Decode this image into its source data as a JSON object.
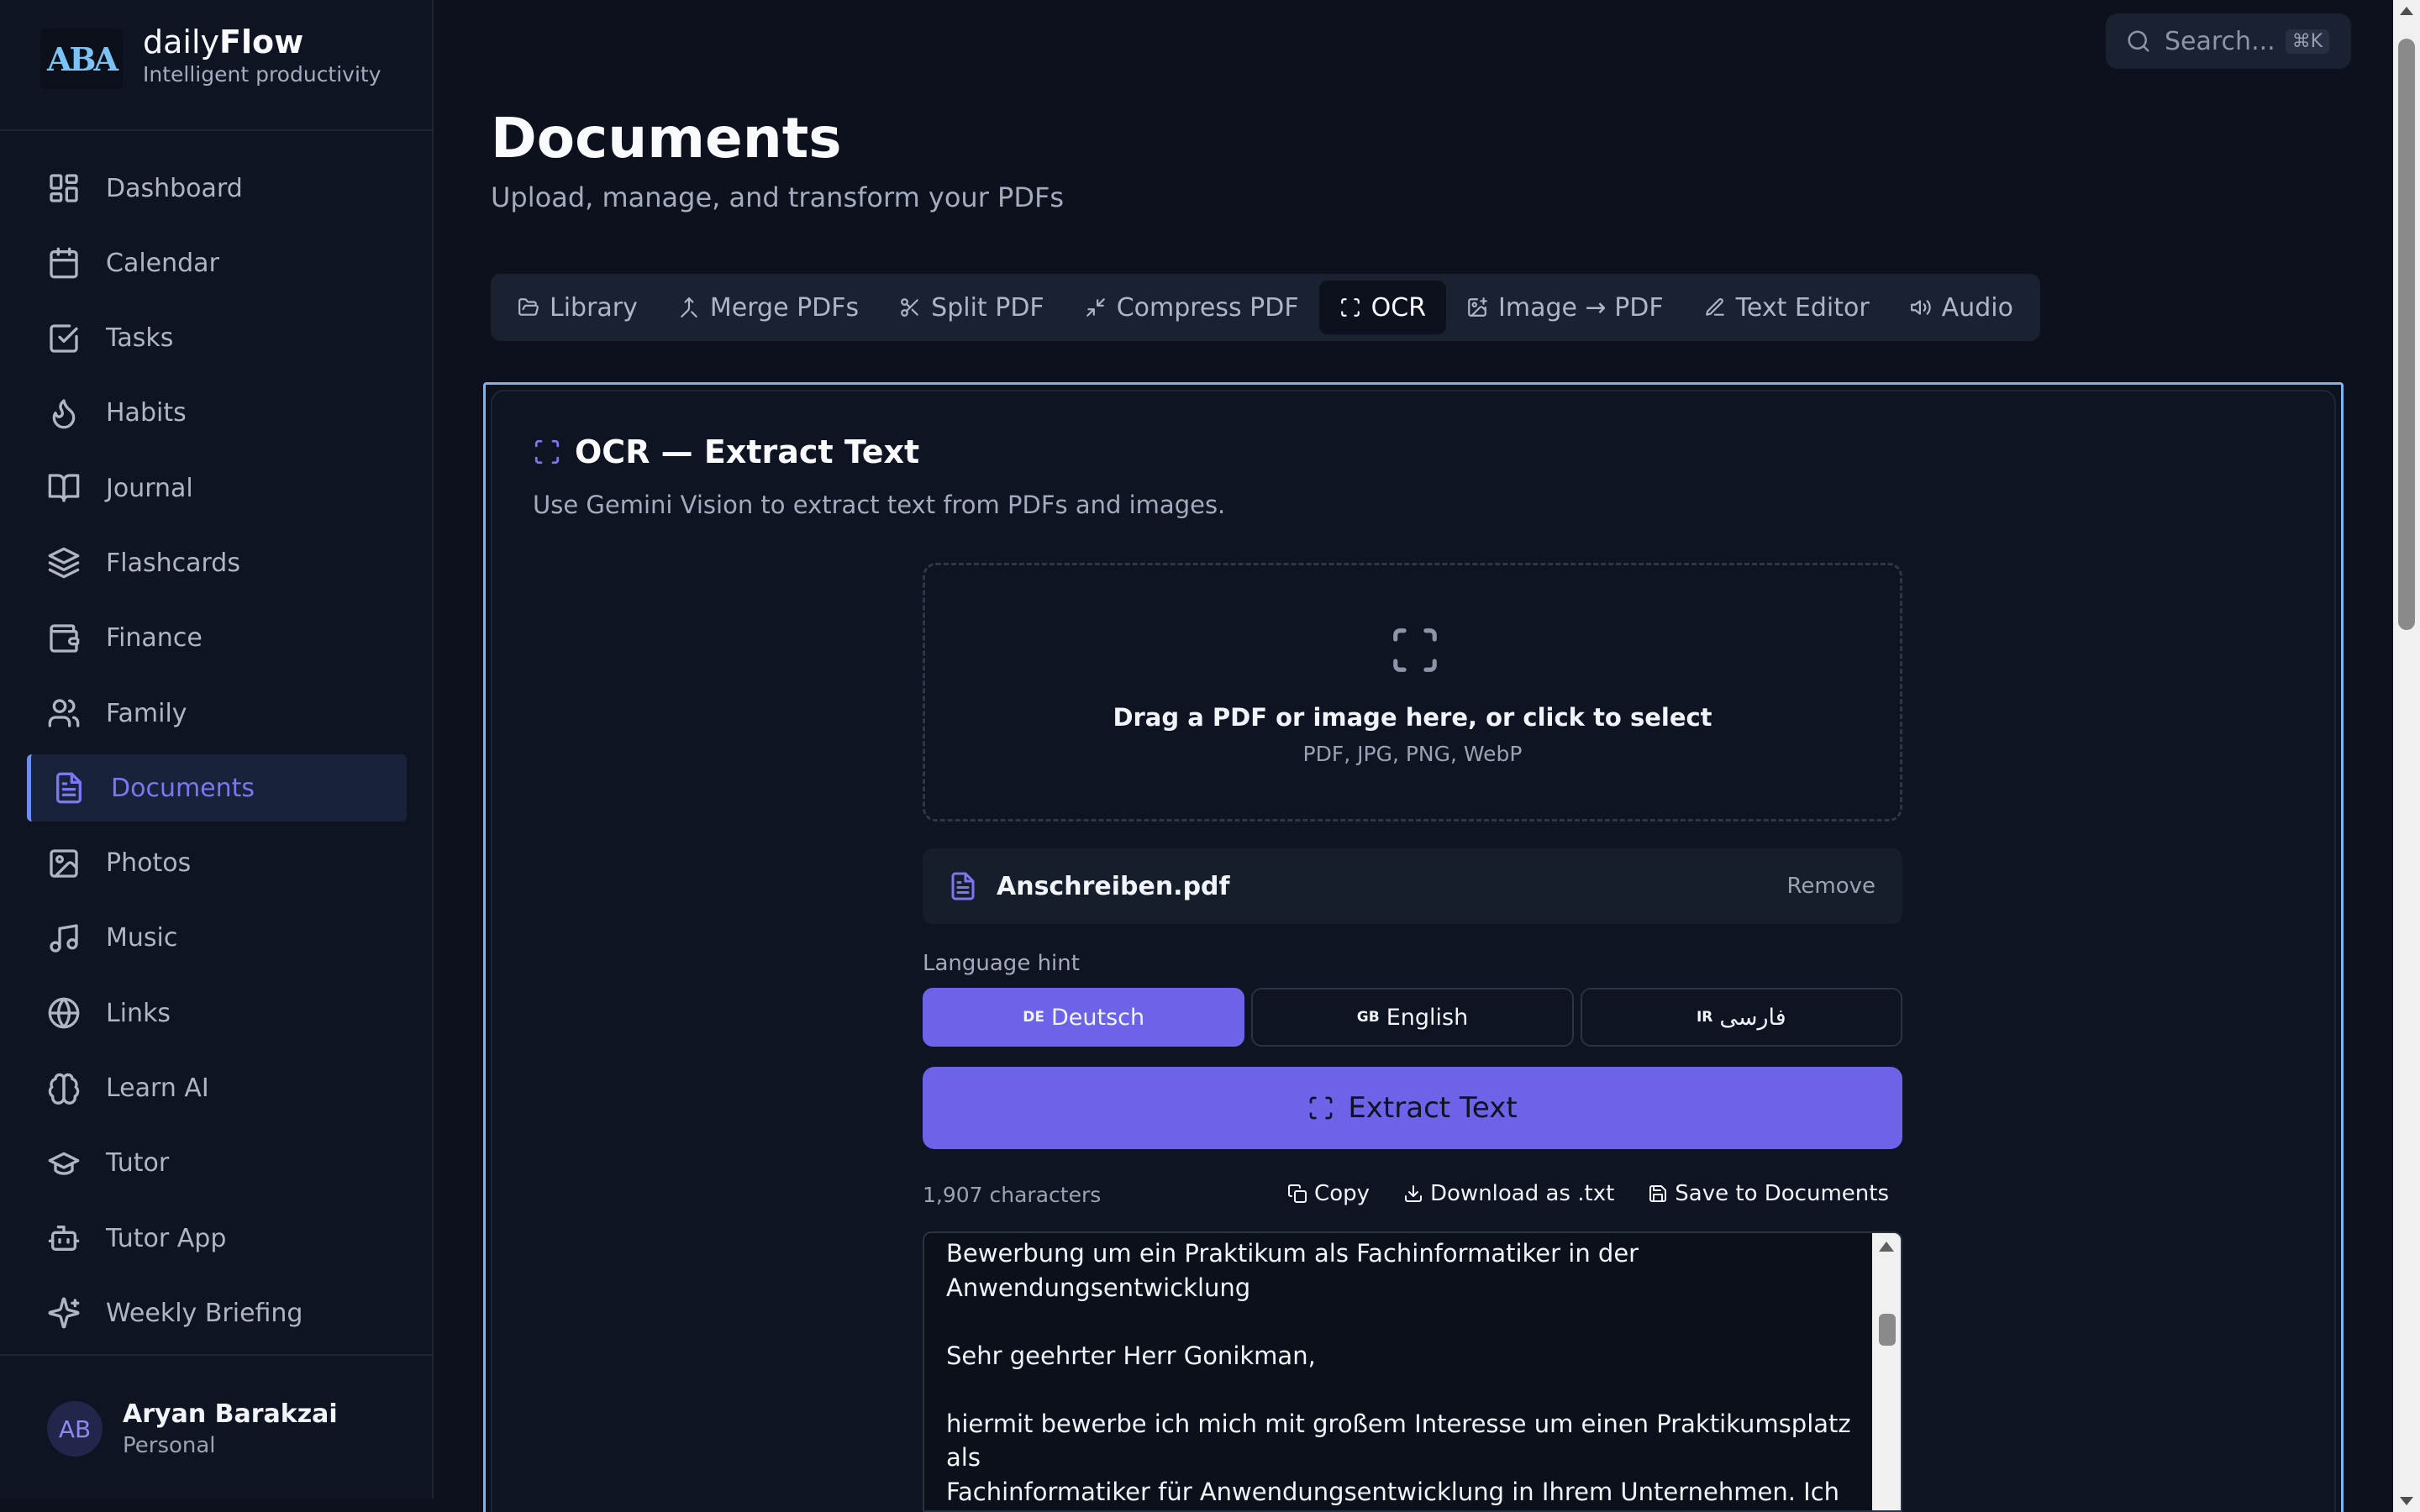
{
  "brand": {
    "logo_text": "ABA",
    "name_prefix": "daily",
    "name_bold": "Flow",
    "tagline": "Intelligent productivity"
  },
  "sidebar": {
    "items": [
      {
        "label": "Dashboard",
        "icon": "grid-icon"
      },
      {
        "label": "Calendar",
        "icon": "calendar-icon"
      },
      {
        "label": "Tasks",
        "icon": "checkbox-icon"
      },
      {
        "label": "Habits",
        "icon": "flame-icon"
      },
      {
        "label": "Journal",
        "icon": "book-icon"
      },
      {
        "label": "Flashcards",
        "icon": "layers-icon"
      },
      {
        "label": "Finance",
        "icon": "wallet-icon"
      },
      {
        "label": "Family",
        "icon": "users-icon"
      },
      {
        "label": "Documents",
        "icon": "file-text-icon",
        "active": true
      },
      {
        "label": "Photos",
        "icon": "image-icon"
      },
      {
        "label": "Music",
        "icon": "music-icon"
      },
      {
        "label": "Links",
        "icon": "globe-icon"
      },
      {
        "label": "Learn AI",
        "icon": "brain-icon"
      },
      {
        "label": "Tutor",
        "icon": "graduation-cap-icon"
      },
      {
        "label": "Tutor App",
        "icon": "bot-icon"
      },
      {
        "label": "Weekly Briefing",
        "icon": "sparkles-icon"
      }
    ]
  },
  "user": {
    "initials": "AB",
    "name": "Aryan Barakzai",
    "plan": "Personal"
  },
  "search": {
    "placeholder": "Search...",
    "shortcut": "⌘K"
  },
  "page": {
    "title": "Documents",
    "subtitle": "Upload, manage, and transform your PDFs"
  },
  "tabs": [
    {
      "label": "Library",
      "icon": "folder-icon"
    },
    {
      "label": "Merge PDFs",
      "icon": "merge-icon"
    },
    {
      "label": "Split PDF",
      "icon": "scissors-icon"
    },
    {
      "label": "Compress PDF",
      "icon": "minimize-icon"
    },
    {
      "label": "OCR",
      "icon": "scan-icon",
      "active": true
    },
    {
      "label": "Image → PDF",
      "icon": "image-plus-icon"
    },
    {
      "label": "Text Editor",
      "icon": "pencil-icon"
    },
    {
      "label": "Audio",
      "icon": "volume-icon"
    }
  ],
  "ocr": {
    "title": "OCR — Extract Text",
    "subtitle": "Use Gemini Vision to extract text from PDFs and images.",
    "drop_main": "Drag a PDF or image here, or click to select",
    "drop_types": "PDF, JPG, PNG, WebP",
    "file_name": "Anschreiben.pdf",
    "remove_label": "Remove",
    "language_label": "Language hint",
    "languages": [
      {
        "code": "DE",
        "label": "Deutsch",
        "active": true
      },
      {
        "code": "GB",
        "label": "English"
      },
      {
        "code": "IR",
        "label": "فارسی"
      }
    ],
    "extract_label": "Extract Text",
    "char_count": "1,907 characters",
    "copy_label": "Copy",
    "download_label": "Download as .txt",
    "save_label": "Save to Documents",
    "result_text": "Bewerbung um ein Praktikum als Fachinformatiker in der\nAnwendungsentwicklung\n\nSehr geehrter Herr Gonikman,\n\nhiermit bewerbe ich mich mit großem Interesse um einen Praktikumsplatz\nals\nFachinformatiker für Anwendungsentwicklung in Ihrem Unternehmen. Ich"
  },
  "colors": {
    "accent": "#6c63e8",
    "active_nav": "#7c76f0",
    "focus_outline": "#7fb3ee"
  }
}
